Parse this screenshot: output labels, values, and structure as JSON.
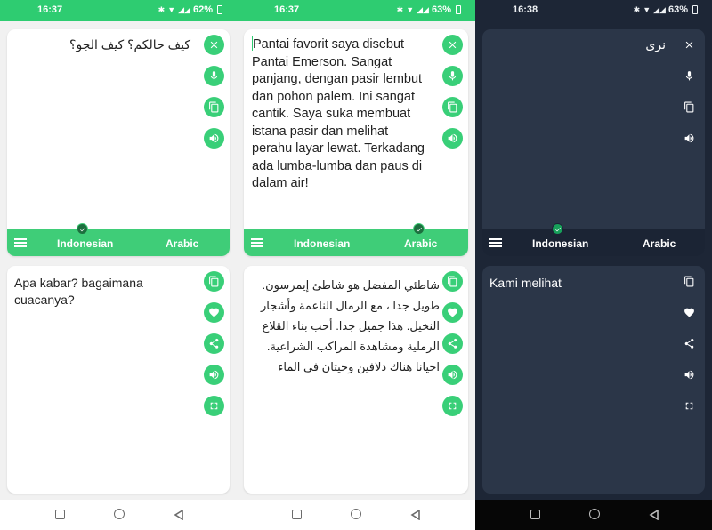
{
  "screens": [
    {
      "time": "16:37",
      "battery": "62%",
      "source_text": "كيف حالكم؟ كيف الجو؟",
      "source_dir": "rtl",
      "result_text": "Apa kabar? bagaimana cuacanya?",
      "result_dir": "ltr",
      "source_lang": "Indonesian",
      "target_lang": "Arabic"
    },
    {
      "time": "16:37",
      "battery": "63%",
      "source_text": "Pantai favorit saya disebut Pantai Emerson. Sangat panjang, dengan pasir lembut dan pohon palem. Ini sangat cantik. Saya suka membuat istana pasir dan melihat perahu layar lewat. Terkadang ada lumba-lumba dan paus di dalam air!",
      "source_dir": "ltr",
      "result_text": "شاطئي المفضل هو شاطئ إيمرسون. طويل جدا ، مع الرمال الناعمة وأشجار النخيل. هذا جميل جدا. أحب بناء القلاع الرملية ومشاهدة المراكب الشراعية. احيانا هناك دلافين وحيتان في الماء",
      "result_dir": "rtl",
      "source_lang": "Indonesian",
      "target_lang": "Arabic"
    },
    {
      "time": "16:38",
      "battery": "63%",
      "source_text": "نرى",
      "source_dir": "rtl",
      "result_text": "Kami melihat",
      "result_dir": "ltr",
      "source_lang": "Indonesian",
      "target_lang": "Arabic"
    }
  ],
  "icons": {
    "top_buttons": [
      "close-icon",
      "microphone-icon",
      "copy-icon",
      "speaker-icon"
    ],
    "bottom_buttons": [
      "copy-icon",
      "heart-icon",
      "share-icon",
      "speaker-icon",
      "fullscreen-icon"
    ],
    "nav": [
      "recent-apps-icon",
      "home-icon",
      "back-icon"
    ]
  },
  "colors": {
    "accent": "#2ecc71",
    "lang_bar": "#3fcd78",
    "dark_bg": "#1d2636",
    "dark_card": "#2b3648"
  }
}
